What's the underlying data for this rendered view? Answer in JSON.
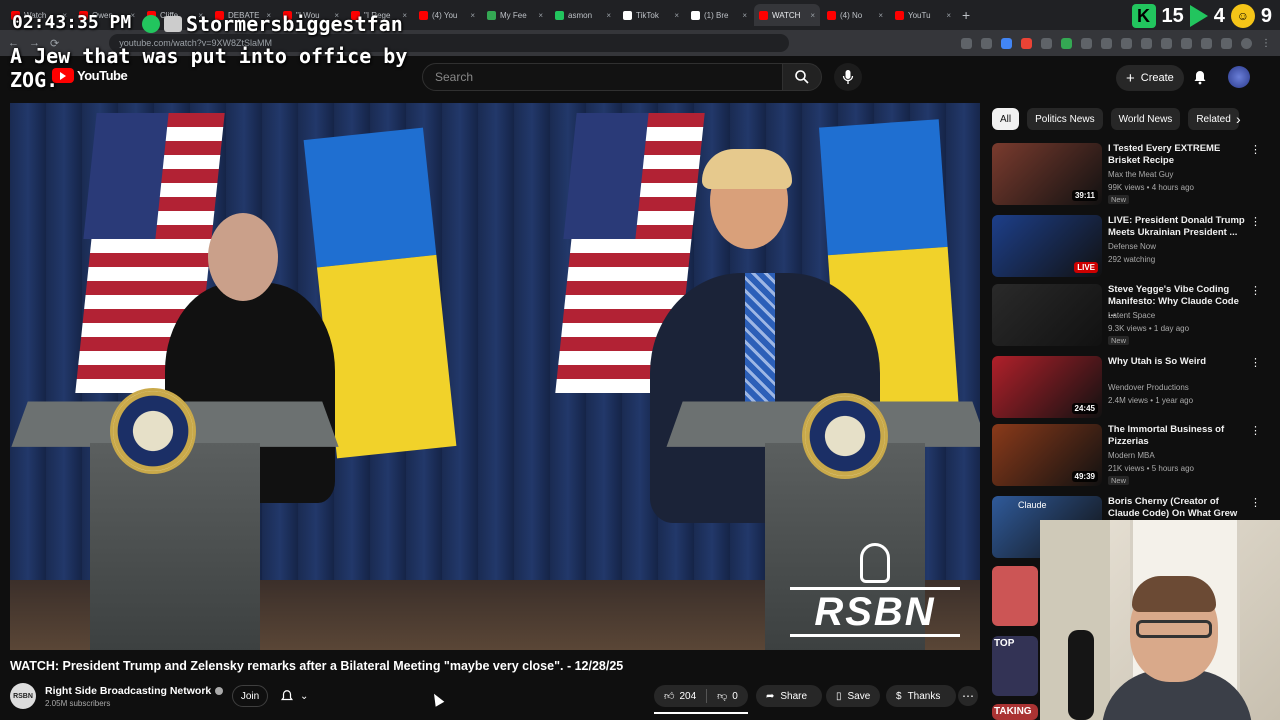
{
  "browser": {
    "tabs": [
      {
        "label": "Watch",
        "color": "#ff0000"
      },
      {
        "label": "Owen",
        "color": "#ff0000"
      },
      {
        "label": "Cliffe",
        "color": "#ff0000"
      },
      {
        "label": "DEBATE",
        "color": "#ff0000"
      },
      {
        "label": "\"I Wou",
        "color": "#ff0000"
      },
      {
        "label": "\"I Rege",
        "color": "#ff0000"
      },
      {
        "label": "(4) You",
        "color": "#ff0000"
      },
      {
        "label": "My Fee",
        "color": "#34a853"
      },
      {
        "label": "asmon",
        "color": "#22c55e"
      },
      {
        "label": "TikTok",
        "color": "#ffffff"
      },
      {
        "label": "(1) Bre",
        "color": "#ffffff"
      },
      {
        "label": "WATCH",
        "color": "#ff0000",
        "active": true
      },
      {
        "label": "(4) No",
        "color": "#ff0000"
      },
      {
        "label": "YouTu",
        "color": "#ff0000"
      }
    ],
    "url": "youtube.com/watch?v=9XW8ZtSlaMM"
  },
  "overlay": {
    "clock": "02:43:35 PM",
    "username": "Stormersbiggestfan",
    "caption": "A Jew that was put into office by ZOG.",
    "stat_a": "15",
    "stat_b": "4",
    "stat_c": "9"
  },
  "header": {
    "logo_text": "YouTube",
    "search_placeholder": "Search",
    "create_label": "Create"
  },
  "video": {
    "title": "WATCH: President Trump and Zelensky remarks after a Bilateral Meeting \"maybe very close\". - 12/28/25",
    "watermark": "RSBN",
    "channel": {
      "name": "Right Side Broadcasting Network",
      "avatar_text": "RSBN",
      "subscribers": "2.05M subscribers",
      "join_label": "Join"
    },
    "actions": {
      "likes": "204",
      "dislikes": "0",
      "share": "Share",
      "save": "Save",
      "thanks": "Thanks"
    }
  },
  "chips": [
    "All",
    "Politics News",
    "World News",
    "Related"
  ],
  "recommendations": [
    {
      "title": "I Tested Every EXTREME Brisket Recipe",
      "channel": "Max the Meat Guy",
      "meta": "99K views • 4 hours ago",
      "badge": "New",
      "duration": "39:11",
      "thumb_color": "#7a3b2e"
    },
    {
      "title": "LIVE: President Donald Trump Meets Ukrainian President ...",
      "channel": "Defense Now",
      "meta": "292 watching",
      "badge": "",
      "duration": "LIVE",
      "thumb_color": "#1d3f8a"
    },
    {
      "title": "Steve Yegge's Vibe Coding Manifesto: Why Claude Code ...",
      "channel": "Latent Space",
      "meta": "9.3K views • 1 day ago",
      "badge": "New",
      "duration": "",
      "thumb_color": "#2a2a2a"
    },
    {
      "title": "Why Utah is So Weird",
      "channel": "Wendover Productions",
      "meta": "2.4M views • 1 year ago",
      "badge": "",
      "duration": "24:45",
      "thumb_color": "#b0202a"
    },
    {
      "title": "The Immortal Business of Pizzerias",
      "channel": "Modern MBA",
      "meta": "21K views • 5 hours ago",
      "badge": "New",
      "duration": "49:39",
      "thumb_color": "#8a3a1a"
    },
    {
      "title": "Boris Cherny (Creator of Claude Code) On What Grew His Care...",
      "channel": "",
      "meta": "",
      "badge": "",
      "duration": "",
      "thumb_color": "#2f5a9a",
      "thumb_text": "Claude"
    }
  ],
  "partial_thumbs": [
    "",
    "TOP",
    "TAKING"
  ]
}
